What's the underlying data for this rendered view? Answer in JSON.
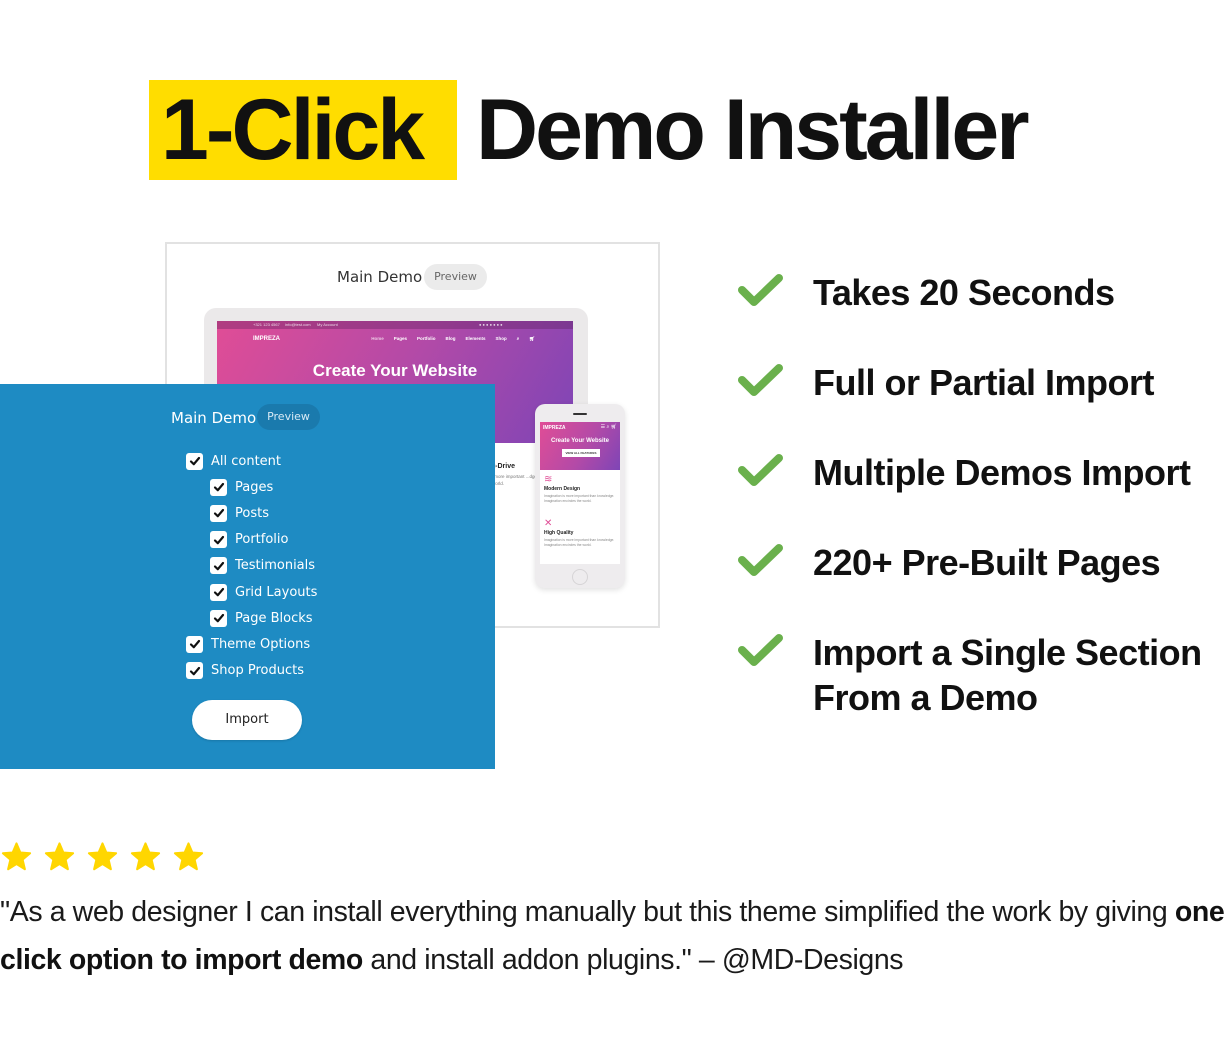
{
  "title": {
    "highlight": "1-Click",
    "rest": "Demo Installer",
    "highlight_color": "#ffdd00"
  },
  "back_preview": {
    "demo_name": "Main Demo",
    "preview_label": "Preview",
    "desktop": {
      "topbar": [
        "+321 123 4567",
        "info@test.com",
        "My Account"
      ],
      "logo": "IMPREZA",
      "nav": [
        "Home",
        "Pages",
        "Portfolio",
        "Blog",
        "Elements",
        "Shop"
      ],
      "hero_title": "Create Your Website",
      "section_title": "...t-Drive",
      "section_text": "...s more important ...dge. Imagination ... world."
    },
    "phone": {
      "logo": "IMPREZA",
      "hero_title": "Create Your Website",
      "button": "VIEW ALL FEATURES",
      "features": [
        {
          "title": "Modern Design",
          "text": "Imagination is more important than knowledge. Imagination encircles the world."
        },
        {
          "title": "High Quality",
          "text": "Imagination is more important than knowledge. Imagination encircles the world."
        }
      ]
    }
  },
  "import_panel": {
    "demo_name": "Main Demo",
    "preview_label": "Preview",
    "background_color": "#1e8bc3",
    "options": [
      {
        "label": "All content",
        "checked": true,
        "level": 0
      },
      {
        "label": "Pages",
        "checked": true,
        "level": 1
      },
      {
        "label": "Posts",
        "checked": true,
        "level": 1
      },
      {
        "label": "Portfolio",
        "checked": true,
        "level": 1
      },
      {
        "label": "Testimonials",
        "checked": true,
        "level": 1
      },
      {
        "label": "Grid Layouts",
        "checked": true,
        "level": 1
      },
      {
        "label": "Page Blocks",
        "checked": true,
        "level": 1
      },
      {
        "label": "Theme Options",
        "checked": true,
        "level": 0
      },
      {
        "label": "Shop Products",
        "checked": true,
        "level": 0
      }
    ],
    "import_label": "Import"
  },
  "features": {
    "check_color": "#6ab04c",
    "items": [
      "Takes 20 Seconds",
      "Full or Partial Import",
      "Multiple Demos Import",
      "220+ Pre-Built Pages",
      "Import a Single Section\nFrom a Demo"
    ]
  },
  "testimonial": {
    "rating": 5,
    "rating_max": 5,
    "star_color": "#ffd600",
    "quote_before": "\"As a web designer I can install everything manually but this theme simplified the work by giving ",
    "quote_bold": "one click option to import demo",
    "quote_after": " and install addon plugins.\" – @MD-Designs"
  }
}
